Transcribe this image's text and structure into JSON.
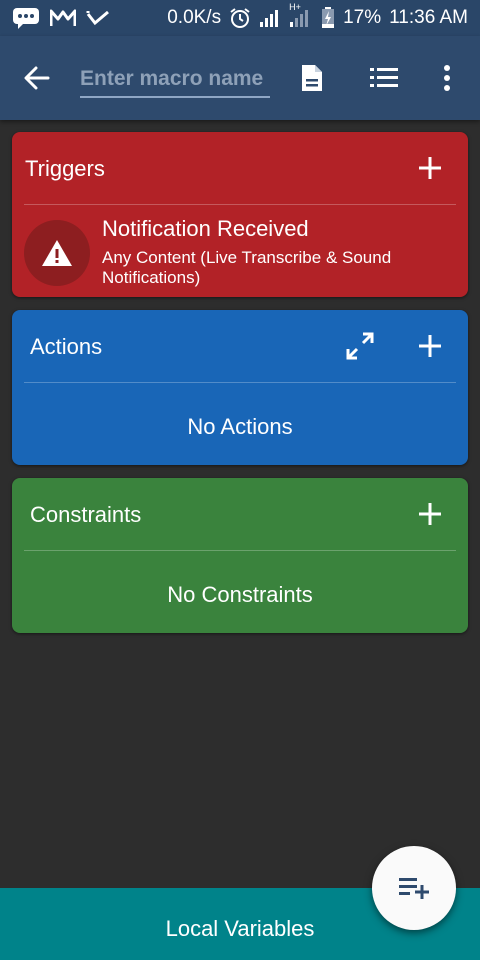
{
  "status_bar": {
    "net_speed": "0.0K/s",
    "network_type": "H+",
    "battery": "17%",
    "time": "11:36 AM",
    "icons": [
      "message-icon",
      "gmail-icon",
      "check-icon",
      "alarm-icon",
      "signal-icon",
      "signal-icon",
      "battery-charging-icon"
    ]
  },
  "toolbar": {
    "back_icon": "arrow-left-icon",
    "name_placeholder": "Enter macro name",
    "icons": [
      "document-icon",
      "list-icon",
      "more-vert-icon"
    ]
  },
  "triggers": {
    "title": "Triggers",
    "color": "#b22227",
    "items": [
      {
        "icon": "warning-icon",
        "title": "Notification Received",
        "subtitle": "Any Content (Live Transcribe & Sound Notifications)"
      }
    ]
  },
  "actions": {
    "title": "Actions",
    "color": "#1966b7",
    "empty_text": "No Actions"
  },
  "constraints": {
    "title": "Constraints",
    "color": "#3a833d",
    "empty_text": "No Constraints"
  },
  "bottom": {
    "label": "Local Variables",
    "color": "#00838a",
    "fab_icon": "playlist-add-icon"
  }
}
